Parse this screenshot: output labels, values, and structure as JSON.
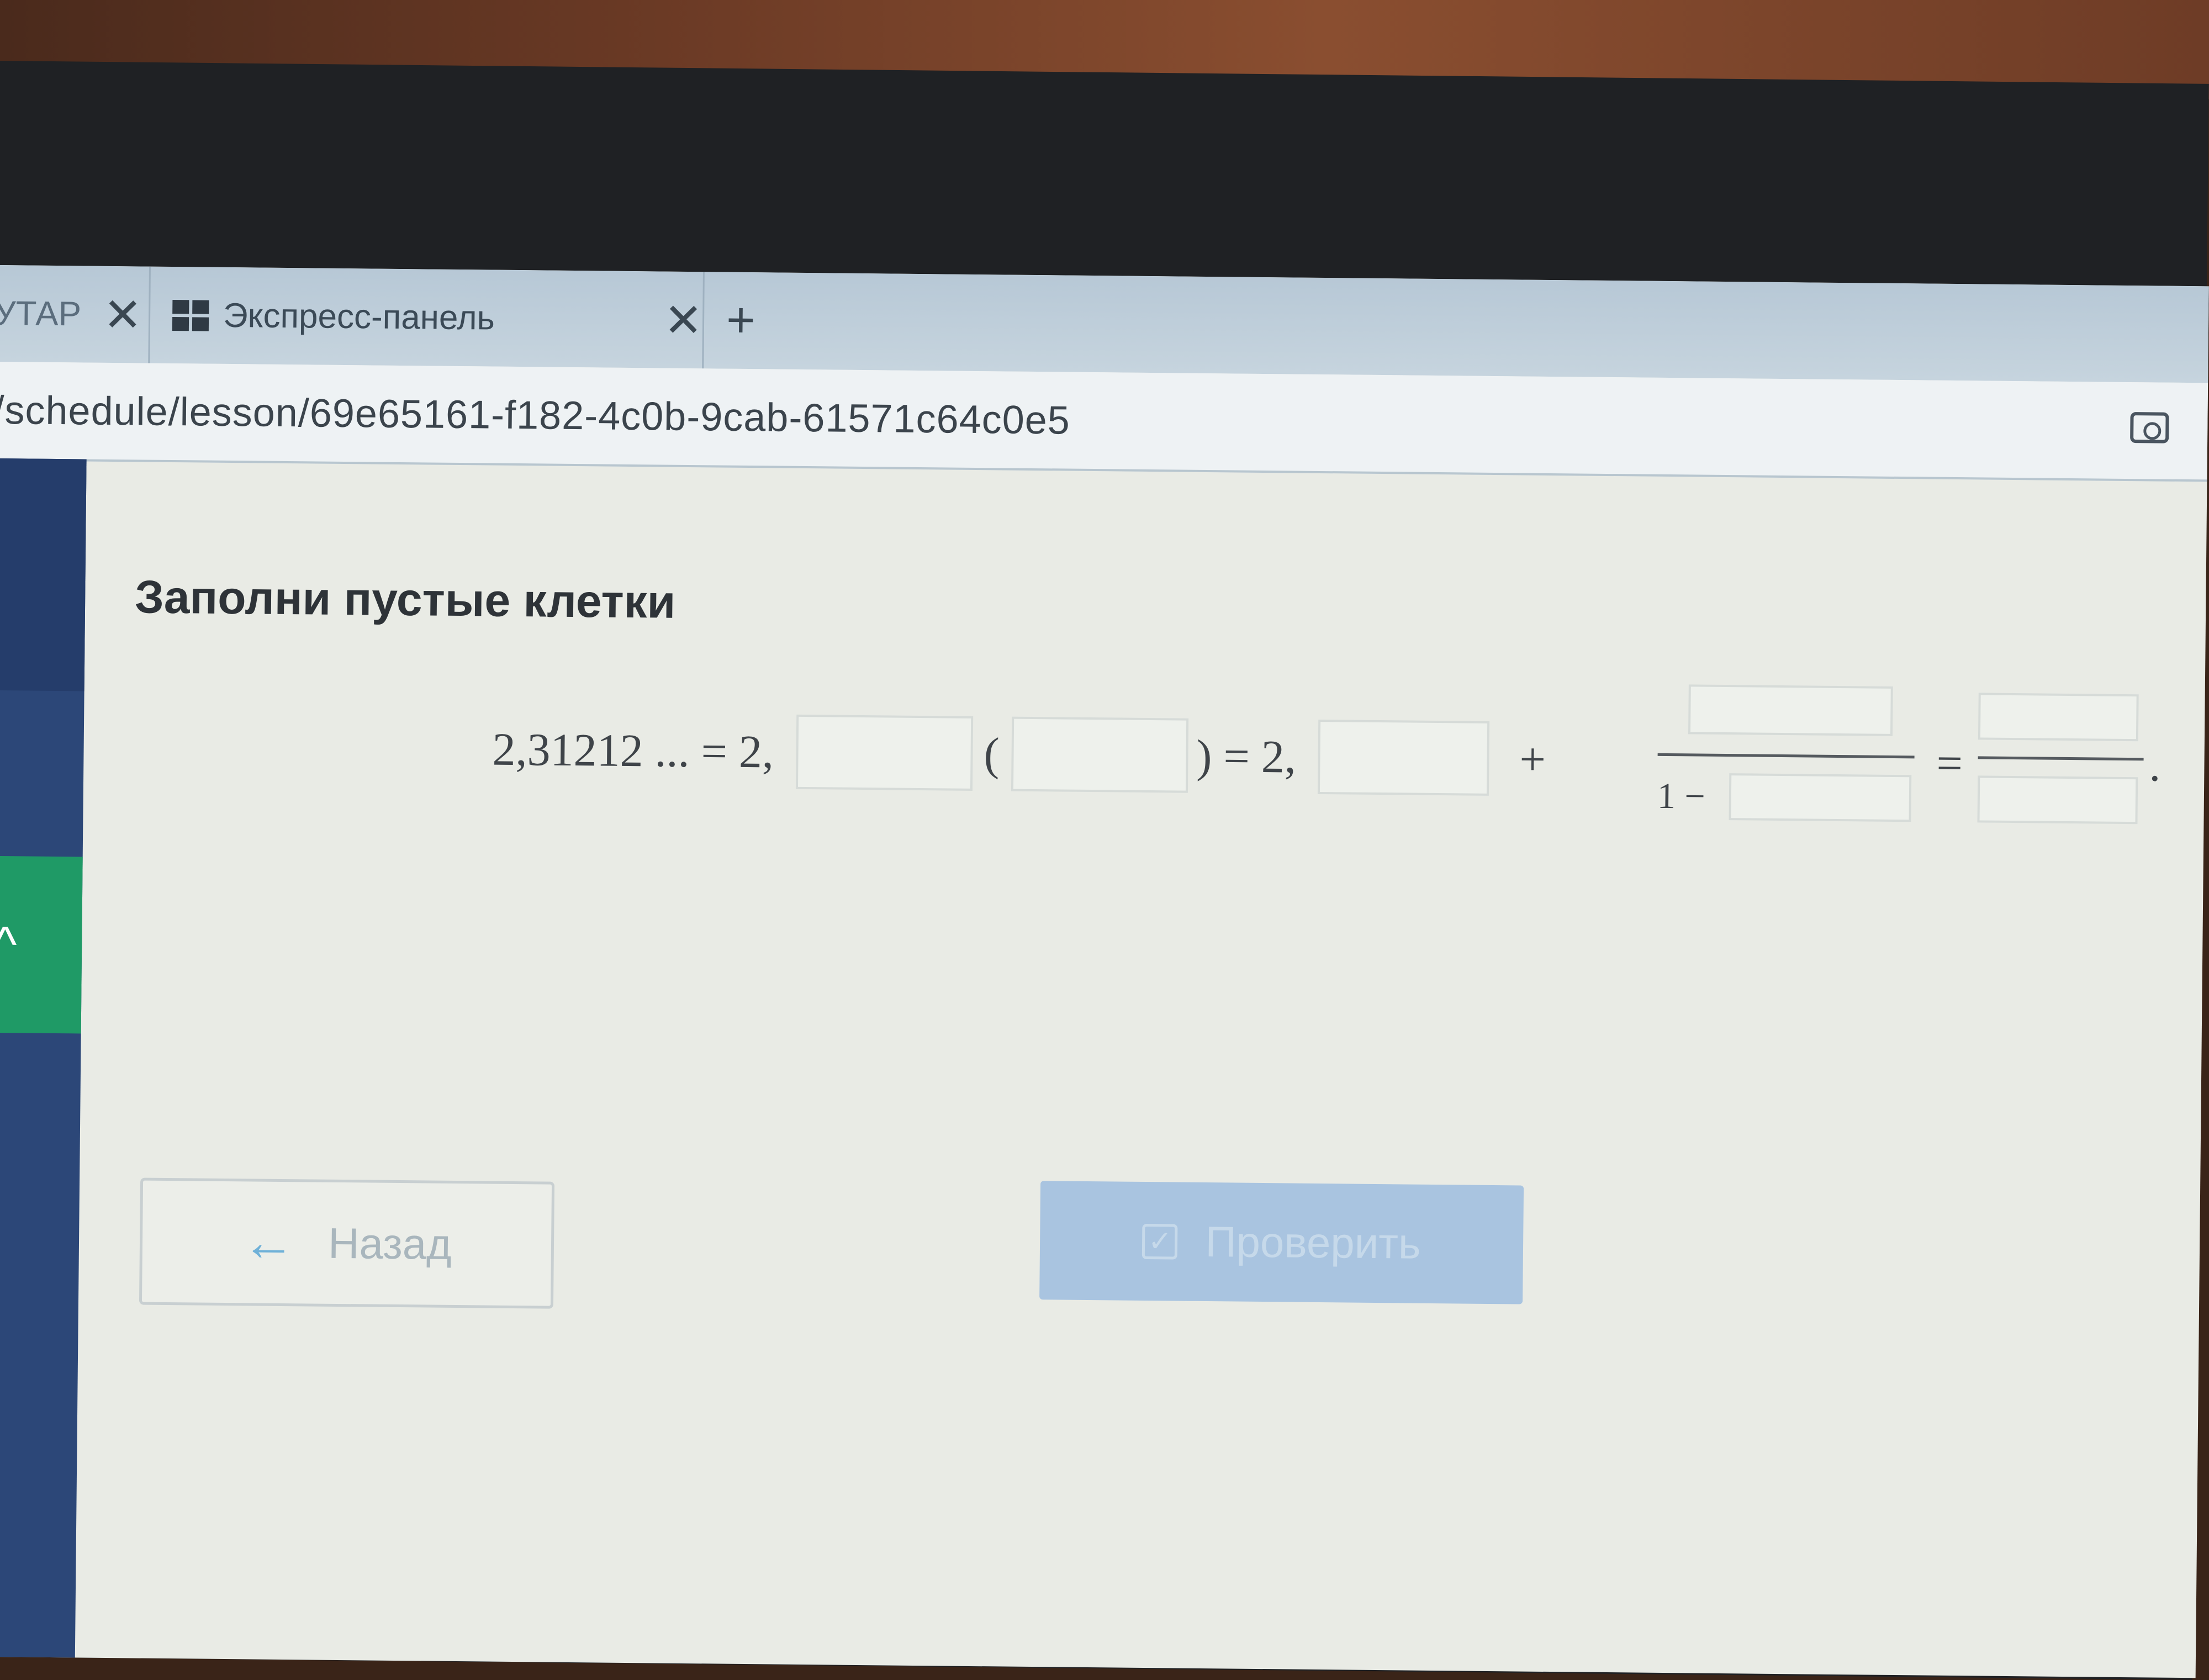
{
  "browser": {
    "tabs": [
      {
        "label": "УТАР",
        "close": "✕"
      },
      {
        "label": "Экспресс-панель",
        "close": "✕"
      }
    ],
    "new_tab": "+",
    "url": "/schedule/lesson/69e65161-f182-4c0b-9cab-61571c64c0e5"
  },
  "task": {
    "title": "Заполни пустые клетки",
    "equation": {
      "lhs": "2,31212 ... = 2,",
      "open_paren": "(",
      "close_paren_eq": ") = 2,",
      "plus": "+",
      "denominator_prefix": "1 −",
      "equals": "=",
      "period": "."
    }
  },
  "buttons": {
    "back_label": "Назад",
    "check_label": "Проверить"
  },
  "colors": {
    "sidebar": "#2c4778",
    "sidebar_active": "#1f9a66",
    "check_button": "#a9c4e0"
  }
}
